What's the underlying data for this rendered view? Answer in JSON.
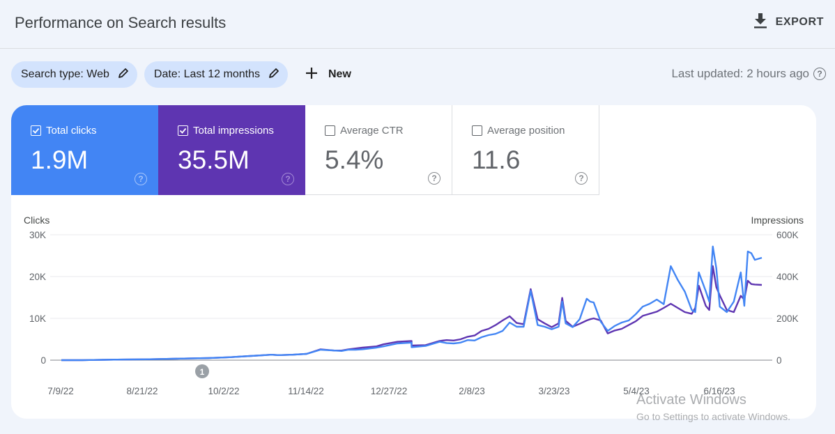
{
  "header": {
    "title": "Performance on Search results",
    "export_label": "EXPORT",
    "export_icon": "download-icon"
  },
  "filters": {
    "chips": [
      {
        "label": "Search type: Web",
        "icon": "edit-pencil-icon"
      },
      {
        "label": "Date: Last 12 months",
        "icon": "edit-pencil-icon"
      }
    ],
    "new_label": "New",
    "new_icon": "plus-icon",
    "last_updated": "Last updated: 2 hours ago"
  },
  "metrics": [
    {
      "label": "Total clicks",
      "value": "1.9M",
      "checked": true,
      "color": "#4285f4"
    },
    {
      "label": "Total impressions",
      "value": "35.5M",
      "checked": true,
      "color": "#5e35b1"
    },
    {
      "label": "Average CTR",
      "value": "5.4%",
      "checked": false
    },
    {
      "label": "Average position",
      "value": "11.6",
      "checked": false
    }
  ],
  "help_glyph": "?",
  "annotation_marker": "1",
  "watermark": {
    "line1": "Activate Windows",
    "line2": "Go to Settings to activate Windows."
  },
  "chart_data": {
    "type": "line",
    "title": "",
    "x_start": "7/9/22",
    "x_end": "7/8/23",
    "x_ticks": [
      "7/9/22",
      "8/21/22",
      "10/2/22",
      "11/14/22",
      "12/27/22",
      "2/8/23",
      "3/23/23",
      "5/4/23",
      "6/16/23"
    ],
    "left_axis": {
      "label": "Clicks",
      "ticks": [
        "0",
        "10K",
        "20K",
        "30K"
      ],
      "range": [
        0,
        30000
      ]
    },
    "right_axis": {
      "label": "Impressions",
      "ticks": [
        "0",
        "200K",
        "400K",
        "600K"
      ],
      "range": [
        0,
        600000
      ]
    },
    "grid": true,
    "annotations": [
      {
        "label": "1",
        "x_fraction": 0.201
      }
    ],
    "series": [
      {
        "name": "Clicks",
        "axis": "left",
        "color": "#4285f4",
        "x_fraction": [
          0,
          0.03,
          0.06,
          0.09,
          0.12,
          0.15,
          0.18,
          0.21,
          0.24,
          0.27,
          0.29,
          0.3,
          0.31,
          0.33,
          0.35,
          0.37,
          0.39,
          0.4,
          0.41,
          0.42,
          0.43,
          0.45,
          0.46,
          0.48,
          0.5,
          0.5,
          0.52,
          0.54,
          0.55,
          0.56,
          0.57,
          0.58,
          0.59,
          0.6,
          0.61,
          0.62,
          0.63,
          0.64,
          0.65,
          0.66,
          0.67,
          0.68,
          0.69,
          0.7,
          0.71,
          0.715,
          0.72,
          0.73,
          0.74,
          0.75,
          0.755,
          0.76,
          0.77,
          0.78,
          0.79,
          0.8,
          0.81,
          0.82,
          0.83,
          0.84,
          0.85,
          0.86,
          0.87,
          0.88,
          0.89,
          0.9,
          0.905,
          0.91,
          0.92,
          0.925,
          0.93,
          0.935,
          0.94,
          0.95,
          0.96,
          0.97,
          0.975,
          0.98,
          0.985,
          0.99,
          1.0
        ],
        "values": [
          0,
          0,
          80,
          150,
          200,
          300,
          400,
          500,
          700,
          1000,
          1200,
          1300,
          1200,
          1300,
          1500,
          2500,
          2300,
          2200,
          2500,
          2500,
          2600,
          3000,
          3300,
          4000,
          4200,
          3100,
          3400,
          4400,
          4100,
          4000,
          4200,
          4800,
          4700,
          5500,
          6000,
          6300,
          7000,
          9000,
          8000,
          8000,
          16600,
          8400,
          8000,
          7400,
          8000,
          14000,
          8800,
          7900,
          9800,
          14700,
          14000,
          13800,
          9200,
          7000,
          8200,
          9000,
          9500,
          11000,
          12800,
          13500,
          14500,
          13400,
          22500,
          19200,
          16400,
          12000,
          11500,
          21000,
          16500,
          14000,
          27200,
          22000,
          12800,
          11500,
          14000,
          21000,
          13000,
          26000,
          25600,
          24000,
          24500
        ]
      },
      {
        "name": "Impressions",
        "axis": "right",
        "color": "#5e35b1",
        "x_fraction": [
          0,
          0.03,
          0.06,
          0.09,
          0.12,
          0.15,
          0.18,
          0.21,
          0.24,
          0.27,
          0.29,
          0.3,
          0.31,
          0.33,
          0.35,
          0.37,
          0.39,
          0.4,
          0.41,
          0.42,
          0.43,
          0.45,
          0.46,
          0.48,
          0.5,
          0.5,
          0.52,
          0.54,
          0.55,
          0.56,
          0.57,
          0.58,
          0.59,
          0.6,
          0.61,
          0.62,
          0.63,
          0.64,
          0.65,
          0.66,
          0.67,
          0.68,
          0.69,
          0.7,
          0.71,
          0.715,
          0.72,
          0.73,
          0.74,
          0.75,
          0.755,
          0.76,
          0.77,
          0.78,
          0.79,
          0.8,
          0.81,
          0.82,
          0.83,
          0.84,
          0.85,
          0.86,
          0.87,
          0.88,
          0.89,
          0.9,
          0.905,
          0.91,
          0.92,
          0.925,
          0.93,
          0.935,
          0.94,
          0.95,
          0.96,
          0.97,
          0.975,
          0.98,
          0.985,
          0.99,
          1.0
        ],
        "values": [
          0,
          0,
          1600,
          3000,
          4000,
          6000,
          8000,
          10000,
          14000,
          20000,
          24000,
          26000,
          24000,
          26000,
          30000,
          52000,
          46000,
          46000,
          52000,
          56000,
          60000,
          66000,
          76000,
          88000,
          92000,
          70000,
          72000,
          92000,
          96000,
          94000,
          100000,
          112000,
          118000,
          140000,
          150000,
          168000,
          190000,
          210000,
          178000,
          172000,
          340000,
          196000,
          176000,
          158000,
          176000,
          298000,
          188000,
          160000,
          174000,
          190000,
          196000,
          200000,
          190000,
          128000,
          142000,
          150000,
          168000,
          186000,
          212000,
          222000,
          232000,
          250000,
          270000,
          250000,
          230000,
          222000,
          250000,
          356000,
          260000,
          240000,
          450000,
          350000,
          310000,
          240000,
          230000,
          308000,
          290000,
          380000,
          364000,
          362000,
          360000
        ]
      }
    ]
  }
}
